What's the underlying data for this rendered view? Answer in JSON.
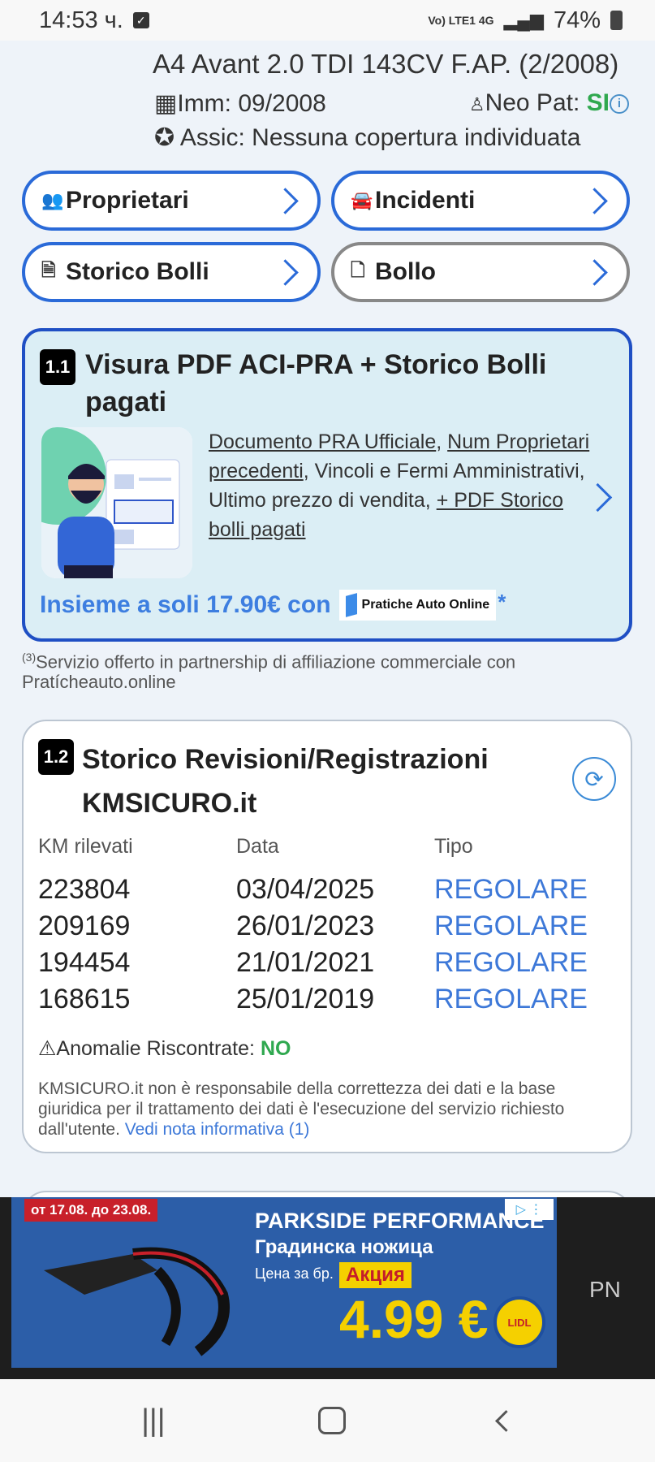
{
  "status": {
    "time": "14:53 ч.",
    "network": "Vo) LTE1 4G",
    "battery": "74%"
  },
  "vehicle": {
    "title": "A4 Avant 2.0 TDI 143CV F.AP. (2/2008)",
    "imm": "Imm: 09/2008",
    "neopat_label": "Neo Pat:",
    "neopat_value": "SI",
    "assic": "Assic: Nessuna copertura individuata"
  },
  "nav_buttons": {
    "proprietari": "Proprietari",
    "incidenti": "Incidenti",
    "storico_bolli": "Storico Bolli",
    "bollo": "Bollo"
  },
  "card_visura": {
    "number": "1.1",
    "title": "Visura PDF ACI-PRA + Storico Bolli pagati",
    "desc_link1": "Documento PRA Ufficiale",
    "desc_sep1": ", ",
    "desc_link2": "Num Proprietari precedenti",
    "desc_text": ", Vincoli e Fermi Amministrativi, Ultimo prezzo di vendita, ",
    "desc_link3": "+ PDF Storico bolli pagati",
    "promo": "Insieme a soli 17.90€ con",
    "partner": "Pratiche Auto Online",
    "star": "*"
  },
  "note": {
    "sup": "(3)",
    "text": "Servizio offerto in partnership di affiliazione commerciale con Pratícheauto.online"
  },
  "card_revisioni": {
    "number": "1.2",
    "title": "Storico Revisioni/Registrazioni KMSICURO.it",
    "headers": [
      "KM rilevati",
      "Data",
      "Tipo"
    ],
    "rows": [
      [
        "223804",
        "03/04/2025",
        "REGOLARE"
      ],
      [
        "209169",
        "26/01/2023",
        "REGOLARE"
      ],
      [
        "194454",
        "21/01/2021",
        "REGOLARE"
      ],
      [
        "168615",
        "25/01/2019",
        "REGOLARE"
      ]
    ],
    "anomalie_label": "Anomalie Riscontrate:",
    "anomalie_value": "NO",
    "disclaimer": "KMSICURO.it non è responsabile della correttezza dei dati e la base giuridica per il trattamento dei dati è l'esecuzione del servizio richiesto dall'utente.",
    "link": "Vedi nota informativa (1)"
  },
  "ad": {
    "date": "от 17.08. до 23.08.",
    "line1": "PARKSIDE PERFORMANCE",
    "line2": "Градинска ножица",
    "line3": "Цена за бр.",
    "promo": "Акция",
    "price": "4.99 €",
    "brand": "LIDL",
    "right_text": "PN"
  },
  "colors": {
    "accent": "#2a6ad8",
    "success": "#2fa84f",
    "card_bg": "#dbeef5"
  },
  "icons": [
    "check-icon",
    "battery-icon",
    "calendar-icon",
    "user-icon",
    "info-icon",
    "award-icon",
    "users-icon",
    "car-icon",
    "document-icon",
    "file-icon",
    "chevron-right-icon",
    "refresh-icon",
    "warning-icon"
  ]
}
